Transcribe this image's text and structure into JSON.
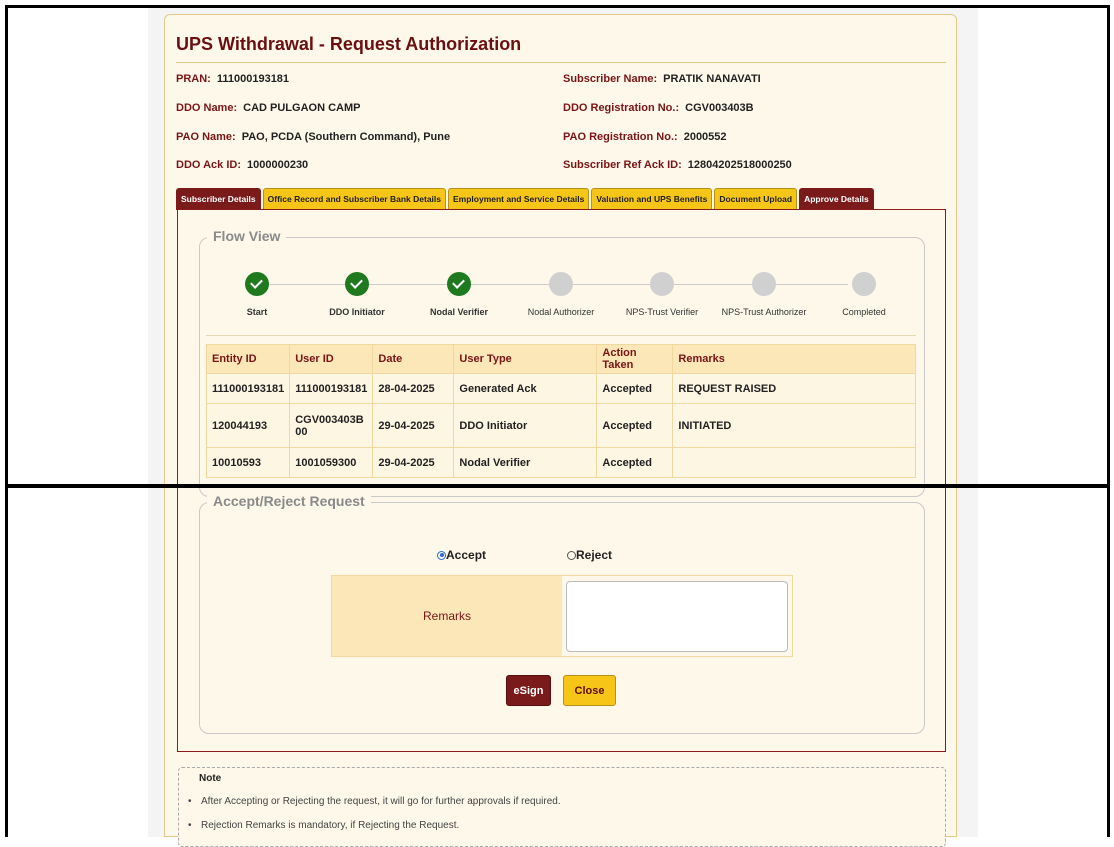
{
  "page": {
    "title": "UPS Withdrawal - Request Authorization"
  },
  "info": {
    "pran_label": "PRAN:",
    "pran_value": "111000193181",
    "subscriber_name_label": "Subscriber Name:",
    "subscriber_name_value": "PRATIK NANAVATI",
    "ddo_name_label": "DDO Name:",
    "ddo_name_value": "CAD PULGAON CAMP",
    "ddo_reg_label": "DDO Registration No.:",
    "ddo_reg_value": "CGV003403B",
    "pao_name_label": "PAO Name:",
    "pao_name_value": "PAO, PCDA (Southern Command), Pune",
    "pao_reg_label": "PAO Registration No.:",
    "pao_reg_value": "2000552",
    "ddo_ack_label": "DDO Ack ID:",
    "ddo_ack_value": "1000000230",
    "sub_ref_ack_label": "Subscriber Ref Ack ID:",
    "sub_ref_ack_value": "12804202518000250"
  },
  "tabs": [
    {
      "label": "Subscriber Details"
    },
    {
      "label": "Office Record and Subscriber Bank Details"
    },
    {
      "label": "Employment and Service Details"
    },
    {
      "label": "Valuation and UPS Benefits"
    },
    {
      "label": "Document Upload"
    },
    {
      "label": "Approve Details"
    }
  ],
  "flow_view": {
    "legend": "Flow View",
    "steps": [
      {
        "label": "Start",
        "status": "done"
      },
      {
        "label": "DDO Initiator",
        "status": "done"
      },
      {
        "label": "Nodal Verifier",
        "status": "done"
      },
      {
        "label": "Nodal Authorizer",
        "status": "pending"
      },
      {
        "label": "NPS-Trust Verifier",
        "status": "pending"
      },
      {
        "label": "NPS-Trust Authorizer",
        "status": "pending"
      },
      {
        "label": "Completed",
        "status": "pending"
      }
    ],
    "table": {
      "headers": [
        "Entity ID",
        "User ID",
        "Date",
        "User Type",
        "Action Taken",
        "Remarks"
      ],
      "rows": [
        [
          "111000193181",
          "111000193181",
          "28-04-2025",
          "Generated Ack",
          "Accepted",
          "REQUEST RAISED"
        ],
        [
          "120044193",
          "CGV003403B 00",
          "29-04-2025",
          "DDO Initiator",
          "Accepted",
          "INITIATED"
        ],
        [
          "10010593",
          "1001059300",
          "29-04-2025",
          "Nodal Verifier",
          "Accepted",
          ""
        ]
      ]
    }
  },
  "decision": {
    "legend": "Accept/Reject Request",
    "accept_label": "Accept",
    "reject_label": "Reject",
    "selected": "Accept",
    "remarks_label": "Remarks",
    "remarks_value": "",
    "esign_label": "eSign",
    "close_label": "Close"
  },
  "note": {
    "title": "Note",
    "items": [
      "After Accepting or Rejecting the request, it will go for further approvals if required.",
      "Rejection Remarks is mandatory, if Rejecting the Request."
    ]
  },
  "colors": {
    "brand_dark": "#7b1a1a",
    "brand_gold": "#f5c518",
    "done_green": "#1f7a1f",
    "pending_gray": "#d0d0d0",
    "radio_blue": "#2a6bd1"
  }
}
